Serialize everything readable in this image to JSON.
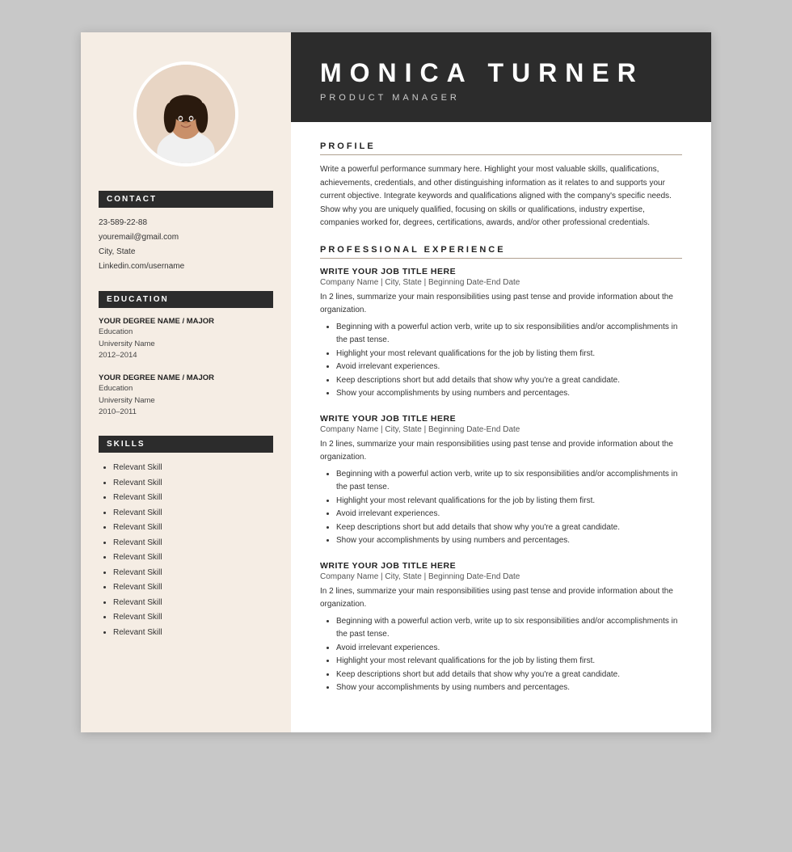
{
  "header": {
    "name": "MONICA TURNER",
    "title": "PRODUCT MANAGER"
  },
  "left": {
    "contact_heading": "CONTACT",
    "contact": {
      "phone": "23-589-22-88",
      "email": "youremail@gmail.com",
      "location": "City, State",
      "linkedin": "Linkedin.com/username"
    },
    "education_heading": "EDUCATION",
    "education": [
      {
        "degree": "YOUR DEGREE NAME / MAJOR",
        "label": "Education",
        "university": "University Name",
        "years": "2012–2014"
      },
      {
        "degree": "YOUR DEGREE NAME / MAJOR",
        "label": "Education",
        "university": "University Name",
        "years": "2010–2011"
      }
    ],
    "skills_heading": "SKILLS",
    "skills": [
      "Relevant Skill",
      "Relevant Skill",
      "Relevant Skill",
      "Relevant Skill",
      "Relevant Skill",
      "Relevant Skill",
      "Relevant Skill",
      "Relevant Skill",
      "Relevant Skill",
      "Relevant Skill",
      "Relevant Skill",
      "Relevant Skill"
    ]
  },
  "right": {
    "profile_heading": "PROFILE",
    "profile_text": "Write a powerful performance summary here. Highlight your most valuable skills, qualifications, achievements, credentials, and other distinguishing information as it relates to and supports your current objective. Integrate keywords and qualifications aligned with the company's specific needs. Show why you are uniquely qualified, focusing on skills or qualifications, industry expertise, companies worked for, degrees, certifications, awards, and/or other professional credentials.",
    "experience_heading": "PROFESSIONAL EXPERIENCE",
    "jobs": [
      {
        "title": "WRITE YOUR JOB TITLE HERE",
        "meta": "Company Name | City, State | Beginning Date-End Date",
        "description": "In 2 lines, summarize your main responsibilities using past tense and provide information about the organization.",
        "bullets": [
          "Beginning with a powerful action verb, write up to six responsibilities and/or accomplishments in the past tense.",
          "Highlight your most relevant qualifications for the job by listing them first.",
          "Avoid irrelevant experiences.",
          "Keep descriptions short but add details that show why you're a great candidate.",
          "Show your accomplishments by using numbers and percentages."
        ]
      },
      {
        "title": "WRITE YOUR JOB TITLE HERE",
        "meta": "Company Name | City, State | Beginning Date-End Date",
        "description": "In 2 lines, summarize your main responsibilities using past tense and provide information about the organization.",
        "bullets": [
          "Beginning with a powerful action verb, write up to six responsibilities and/or accomplishments in the past tense.",
          "Highlight your most relevant qualifications for the job by listing them first.",
          "Avoid irrelevant experiences.",
          "Keep descriptions short but add details that show why you're a great candidate.",
          "Show your accomplishments by using numbers and percentages."
        ]
      },
      {
        "title": "WRITE YOUR JOB TITLE HERE",
        "meta": "Company Name | City, State | Beginning Date-End Date",
        "description": "In 2 lines, summarize your main responsibilities using past tense and provide information about the organization.",
        "bullets": [
          "Beginning with a powerful action verb, write up to six responsibilities and/or accomplishments in the past tense.",
          "Avoid irrelevant experiences.",
          "Highlight your most relevant qualifications for the job by listing them first.",
          "Keep descriptions short but add details that show why you're a great candidate.",
          "Show your accomplishments by using numbers and percentages."
        ]
      }
    ]
  }
}
